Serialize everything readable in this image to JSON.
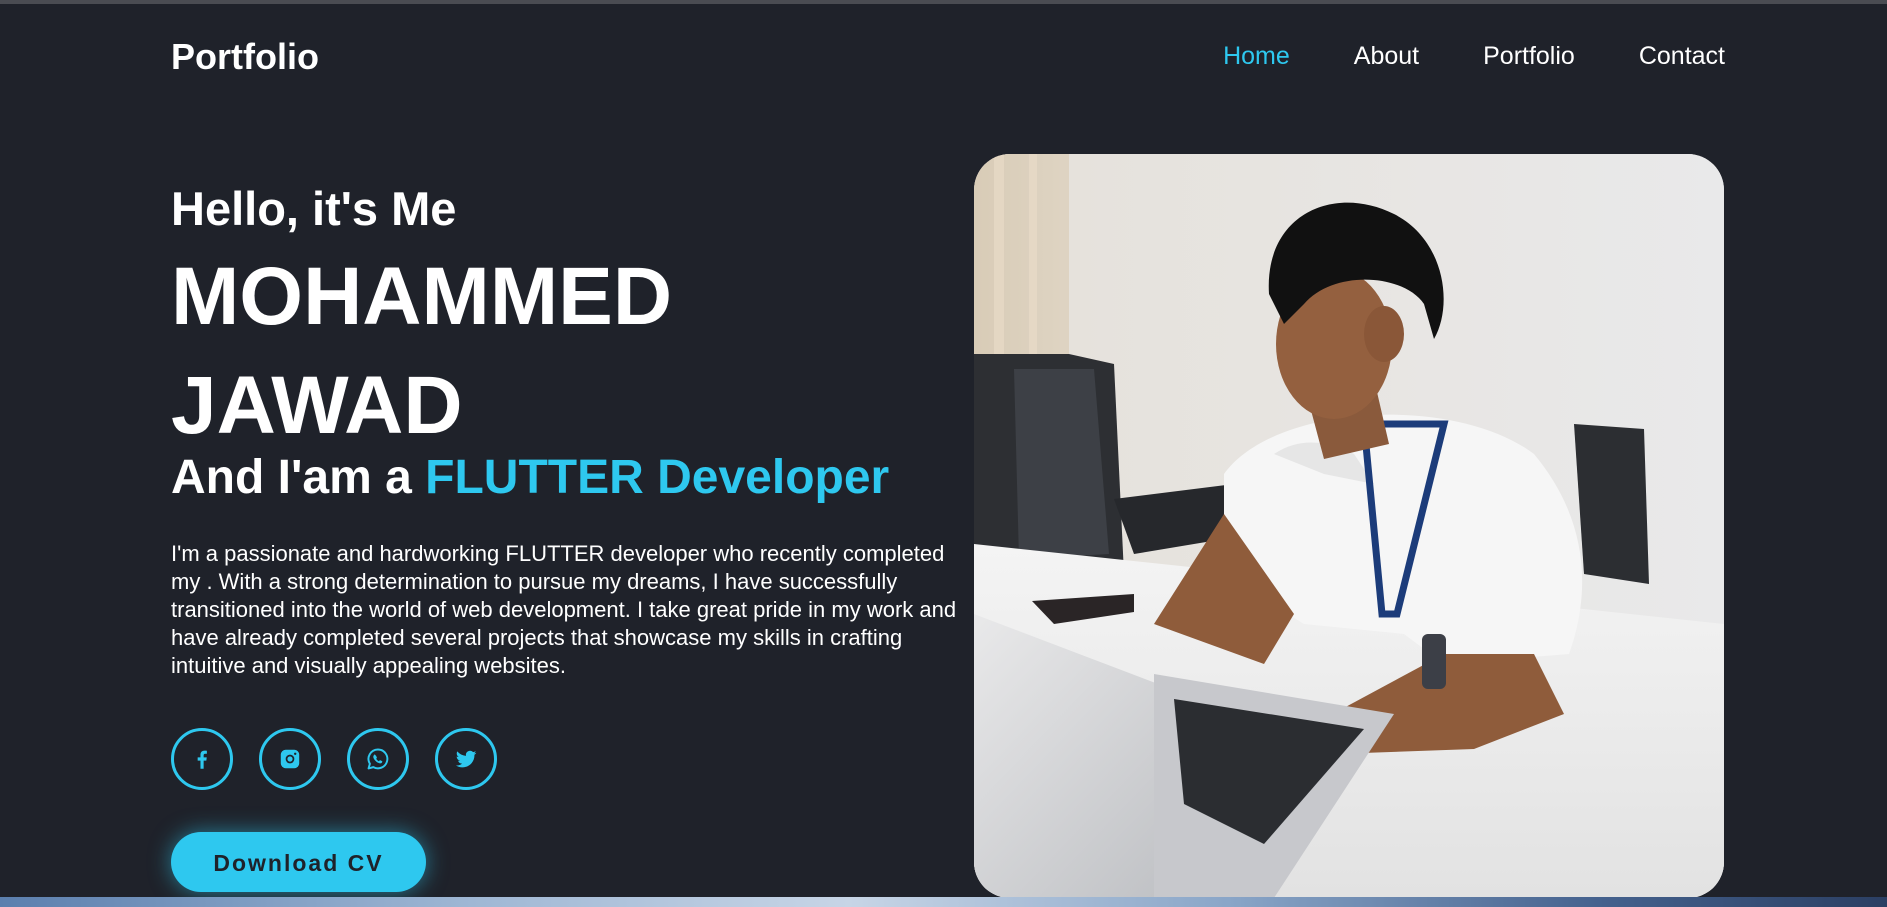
{
  "header": {
    "logo": "Portfolio",
    "nav": [
      {
        "label": "Home",
        "active": true
      },
      {
        "label": "About",
        "active": false
      },
      {
        "label": "Portfolio",
        "active": false
      },
      {
        "label": "Contact",
        "active": false
      }
    ]
  },
  "hero": {
    "greeting": "Hello, it's Me",
    "name_line1": "MOHAMMED",
    "name_line2": "JAWAD",
    "role_prefix": "And I'am a ",
    "role_accent": "FLUTTER Developer",
    "bio": "I'm a passionate and hardworking FLUTTER developer who recently completed my . With a strong determination to pursue my dreams, I have successfully transitioned into the world of web development. I take great pride in my work and have already completed several projects that showcase my skills in crafting intuitive and visually appealing websites.",
    "socials": [
      {
        "icon": "facebook-icon"
      },
      {
        "icon": "instagram-icon"
      },
      {
        "icon": "whatsapp-icon"
      },
      {
        "icon": "twitter-icon"
      }
    ],
    "cv_button": "Download CV"
  },
  "colors": {
    "background": "#1f222a",
    "accent": "#2ec8ef",
    "text": "#ffffff"
  }
}
